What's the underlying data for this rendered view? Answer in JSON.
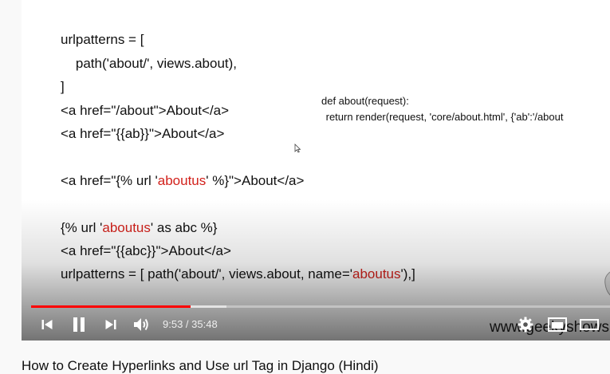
{
  "slide": {
    "lines": [
      "urlpatterns = [",
      "    path('about/', views.about),",
      "]",
      "<a href=\"/about\">About</a>",
      "<a href=\"{{ab}}\">About</a>",
      "<a href=\"{% url '",
      "aboutus",
      "' %}\">About</a>",
      "{% url '",
      "aboutus",
      "' as abc %}",
      "<a href=\"{{abc}}\">About</a>",
      "urlpatterns = [ path('about/', views.about, name='",
      "aboutus",
      "'),]"
    ],
    "side_code": [
      "def about(request):",
      " return render(request, 'core/about.html', {'ab':'/about"
    ],
    "watermark": "www.geekyshows"
  },
  "player": {
    "current_time": "9:53",
    "duration": "35:48",
    "time_display": "9:53 / 35:48",
    "played_fraction": 0.276,
    "buffered_fraction": 0.338,
    "icons": [
      "previous-icon",
      "pause-icon",
      "next-icon",
      "volume-icon",
      "settings-icon",
      "miniplayer-icon",
      "theater-icon"
    ]
  },
  "video": {
    "title": "How to Create Hyperlinks and Use url Tag in Django (Hindi)"
  },
  "colors": {
    "highlight_red": "#d2211b",
    "progress_red": "#ff0000"
  }
}
